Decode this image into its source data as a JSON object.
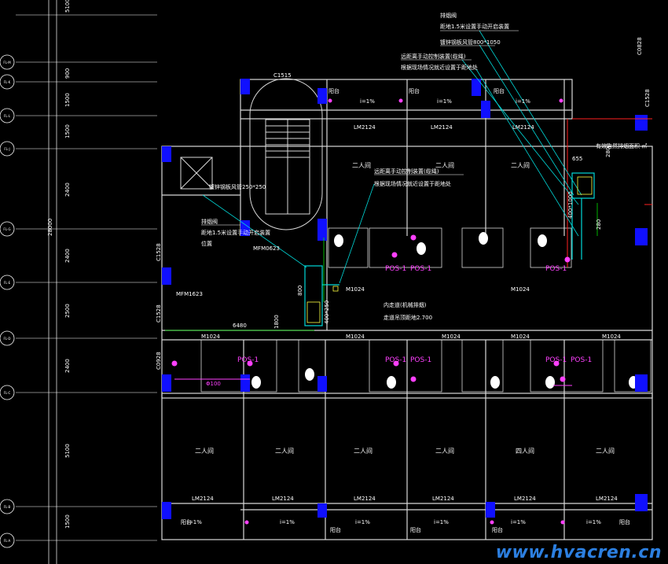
{
  "colors": {
    "wall": "#d8d8d8",
    "grid": "#ffffff",
    "column": "#1010ff",
    "duct": "#00d8d8",
    "pipe": "#ff40ff",
    "green": "#00e000",
    "red": "#ff2020",
    "yellow": "#ffff40",
    "text": "#ffffff"
  },
  "left_dims": [
    "5100",
    "900",
    "1500",
    "1500",
    "2400",
    "2400",
    "2500",
    "2400",
    "5100",
    "1500"
  ],
  "total_dim": "28000",
  "axis_tags": [
    "FL-M",
    "FL-K",
    "FL-L",
    "FL-J",
    "FL-G",
    "FL-E",
    "FL-D",
    "FL-C",
    "FL-B",
    "FL-A"
  ],
  "room_two": "二人间",
  "room_four": "四人间",
  "balcony": "阳台",
  "slope": "i=1%",
  "door_lm": "LM2124",
  "door_m": "M1024",
  "door_mfm": "MFM1623",
  "door_mfm2": "MFM0623",
  "c_labels": [
    "C1515",
    "C1528",
    "C1528",
    "C0928",
    "C0828",
    "C1528"
  ],
  "pos_label": "POS-1",
  "phi": "Φ100",
  "dims_small": [
    "6480",
    "1800",
    "655",
    "2800",
    "280",
    "800"
  ],
  "duct_size_right": "400*1000",
  "duct_size_left": "400*250",
  "corridor": [
    "内走道(机械排烟)",
    "走道吊顶距地2.700"
  ],
  "notes_top": [
    "排烟阀",
    "距地1.5米设置手动开启装置",
    "镀锌钢板风管800*1050",
    "远距离手动控制装置(缆绳)",
    "根据现场情况就近设置于距地处"
  ],
  "notes_mid": [
    "远距离手动控制装置(缆绳)",
    "根据现场情况就近设置于距地处"
  ],
  "notes_left": [
    "镀锌钢板风管250*250",
    "排烟阀",
    "距地1.5米设置手动开启装置",
    "位置"
  ],
  "note_right": "有效自然排烟面积 ㎡",
  "watermark": "www.hvacren.cn"
}
